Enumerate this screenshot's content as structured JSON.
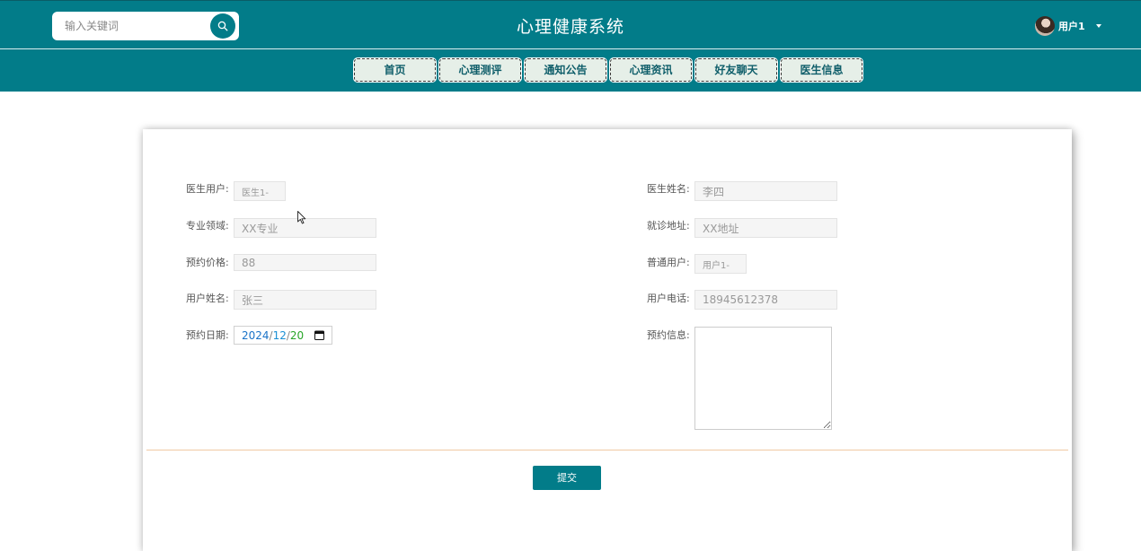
{
  "header": {
    "search_placeholder": "输入关键词",
    "site_title": "心理健康系统",
    "username": "用户1"
  },
  "nav": {
    "items": [
      {
        "label": "首页"
      },
      {
        "label": "心理测评"
      },
      {
        "label": "通知公告"
      },
      {
        "label": "心理资讯"
      },
      {
        "label": "好友聊天"
      },
      {
        "label": "医生信息"
      }
    ]
  },
  "form": {
    "doctor_user": {
      "label": "医生用户:",
      "value": "医生1-"
    },
    "doctor_name": {
      "label": "医生姓名:",
      "value": "李四"
    },
    "specialty": {
      "label": "专业领域:",
      "value": "XX专业"
    },
    "clinic_address": {
      "label": "就诊地址:",
      "value": "XX地址"
    },
    "price": {
      "label": "预约价格:",
      "value": "88"
    },
    "normal_user": {
      "label": "普通用户:",
      "value": "用户1-"
    },
    "user_name": {
      "label": "用户姓名:",
      "value": "张三"
    },
    "user_phone": {
      "label": "用户电话:",
      "value": "18945612378"
    },
    "date": {
      "label": "预约日期:",
      "year": "2024",
      "month": "12",
      "day": "20",
      "separator": "/"
    },
    "info": {
      "label": "预约信息:",
      "value": ""
    },
    "submit_label": "提交"
  },
  "colors": {
    "brand": "#027c89",
    "nav_button_bg": "#e6efe8",
    "divider": "#f0c9a4"
  },
  "icons": {
    "search": "search-icon",
    "calendar": "calendar-icon",
    "caret": "chevron-down-icon",
    "cursor": "mouse-cursor-icon"
  }
}
